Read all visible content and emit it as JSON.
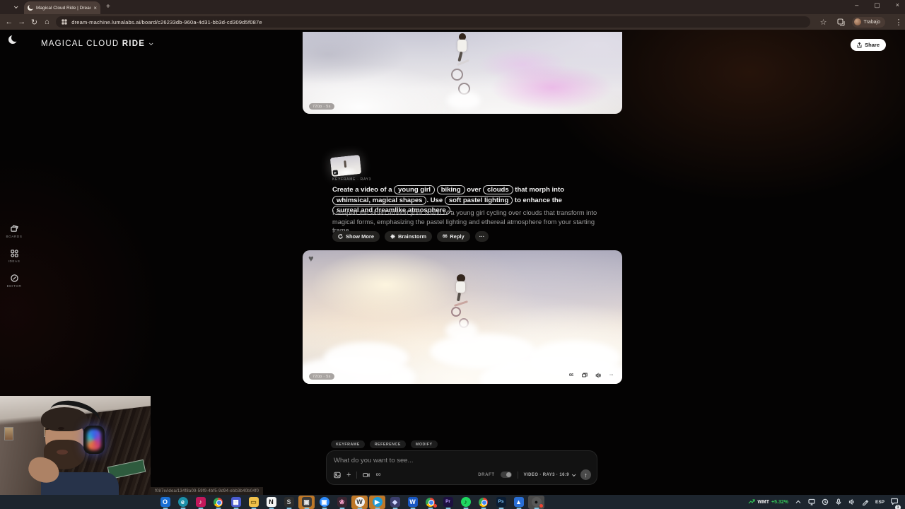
{
  "browser": {
    "tab_title": "Magical Cloud Ride | Dream M...",
    "tab_close": "×",
    "new_tab": "+",
    "window_controls": {
      "minimize": "–",
      "maximize": "▢",
      "close": "×"
    },
    "nav": {
      "back": "←",
      "forward": "→",
      "reload": "↻",
      "home": "⌂"
    },
    "url": "dream-machine.lumalabs.ai/board/c26233db-960a-4d31-bb3d-cd309d5f087e",
    "bookmark_star": "☆",
    "menu_kebab": "⋮",
    "profile_name": "Trabajo"
  },
  "header": {
    "title_regular": "MAGICAL CLOUD",
    "title_bold": "RIDE",
    "share_label": "Share"
  },
  "sidebar": {
    "items": [
      {
        "label": "BOARDS"
      },
      {
        "label": "IDEAS"
      },
      {
        "label": "EDITOR"
      }
    ]
  },
  "videos": {
    "badge_label": "720p · 5s",
    "heart": "♥"
  },
  "generation": {
    "keyframe_label": "KEYFRAME · RAY3",
    "prompt_segments": [
      {
        "type": "text",
        "text": "Create a video of a "
      },
      {
        "type": "pill",
        "text": "young girl"
      },
      {
        "type": "text",
        "text": " "
      },
      {
        "type": "pill",
        "text": "biking"
      },
      {
        "type": "text",
        "text": " over "
      },
      {
        "type": "pill",
        "text": "clouds"
      },
      {
        "type": "text",
        "text": " that morph into "
      },
      {
        "type": "pill",
        "text": "whimsical, magical shapes"
      },
      {
        "type": "text",
        "text": ". Use "
      },
      {
        "type": "pill",
        "text": "soft pastel lighting"
      },
      {
        "type": "text",
        "text": " to enhance the "
      },
      {
        "type": "pill",
        "text": "surreal and dreamlike atmosphere"
      },
      {
        "type": "text",
        "text": "."
      }
    ],
    "description": "I shaped the video around your vision of a young girl cycling over clouds that transform into magical forms, emphasizing the pastel lighting and ethereal atmosphere from your starting frame.",
    "actions": {
      "show_more": "Show More",
      "brainstorm": "Brainstorm",
      "reply": "Reply",
      "more": "···",
      "quote_glyph": "66"
    }
  },
  "video_actions": {
    "quote_glyph": "66",
    "more": "···"
  },
  "composer": {
    "tabs": [
      "KEYFRAME",
      "REFERENCE",
      "MODIFY"
    ],
    "placeholder": "What do you want to see...",
    "plus": "+",
    "loop": "∞",
    "draft_label": "DRAFT",
    "model_label": "VIDEO · RAY3 · 16:9",
    "send_arrow": "↑"
  },
  "statusbar": {
    "link_preview": "f087e/idea/134f8a09-59f9-4bf5-9d94-ebb3b40b04f0"
  },
  "taskbar": {
    "apps": [
      {
        "name": "outlook",
        "glyph": "O",
        "fg": "#ffffff",
        "bg": "#1a6fd4",
        "type": "sq",
        "run": true
      },
      {
        "name": "edge",
        "glyph": "e",
        "fg": "#ffffff",
        "bg": "#1b8fa8",
        "type": "round",
        "run": true
      },
      {
        "name": "music-app",
        "glyph": "♪",
        "fg": "#ffffff",
        "bg": "#c2185b",
        "type": "sq",
        "run": true
      },
      {
        "name": "chrome",
        "glyph": "",
        "fg": "",
        "bg": "",
        "type": "chrome",
        "run": true
      },
      {
        "name": "microsoft-store",
        "glyph": "▦",
        "fg": "#ffffff",
        "bg": "#4a5bd0",
        "type": "sq",
        "run": true
      },
      {
        "name": "file-explorer",
        "glyph": "▭",
        "fg": "#7a5c10",
        "bg": "#f2c14b",
        "type": "sq",
        "run": true
      },
      {
        "name": "notion",
        "glyph": "N",
        "fg": "#111111",
        "bg": "#f4f4f4",
        "type": "sq",
        "run": true
      },
      {
        "name": "sticky-app",
        "glyph": "S",
        "fg": "#cccccc",
        "bg": "#2d2d2d",
        "type": "sq",
        "run": true
      },
      {
        "name": "window-app",
        "glyph": "▣",
        "fg": "#e8e8e8",
        "bg": "#3a3a3a",
        "type": "sq",
        "run": true,
        "chip": "#bf7828"
      },
      {
        "name": "zoom",
        "glyph": "▣",
        "fg": "#ffffff",
        "bg": "#2d8cff",
        "type": "round",
        "run": true
      },
      {
        "name": "flower-app",
        "glyph": "❀",
        "fg": "#f2a0c8",
        "bg": "#3a2430",
        "type": "sq",
        "run": true
      },
      {
        "name": "w-app",
        "glyph": "W",
        "fg": "#333333",
        "bg": "#f0f0f0",
        "type": "round",
        "run": true,
        "chip": "#bf7828"
      },
      {
        "name": "play-app",
        "glyph": "▶",
        "fg": "#ffffff",
        "bg": "#1d9bd8",
        "type": "round",
        "run": true,
        "chip": "#bf7828"
      },
      {
        "name": "purple-app",
        "glyph": "◆",
        "fg": "#cfd8ff",
        "bg": "#3c3f6e",
        "type": "sq",
        "run": true
      },
      {
        "name": "word",
        "glyph": "W",
        "fg": "#ffffff",
        "bg": "#1857c3",
        "type": "sq",
        "run": true
      },
      {
        "name": "chrome-profile2",
        "glyph": "",
        "fg": "",
        "bg": "",
        "type": "chrome",
        "run": true,
        "dot": true
      },
      {
        "name": "premiere-pro",
        "glyph": "Pr",
        "fg": "#b79bff",
        "bg": "#1d1040",
        "type": "sq",
        "run": true
      },
      {
        "name": "spotify",
        "glyph": "♪",
        "fg": "#0d2b14",
        "bg": "#1ed760",
        "type": "round",
        "run": true
      },
      {
        "name": "chrome-profile3",
        "glyph": "",
        "fg": "",
        "bg": "",
        "type": "chrome",
        "run": true
      },
      {
        "name": "photoshop",
        "glyph": "Ps",
        "fg": "#7cc5ff",
        "bg": "#0b1d33",
        "type": "sq",
        "run": true
      },
      {
        "name": "photos-app",
        "glyph": "▲",
        "fg": "#ffffff",
        "bg": "#2a6fd6",
        "type": "sq",
        "run": true
      },
      {
        "name": "recorder-app",
        "glyph": "●",
        "fg": "#101010",
        "bg": "#585858",
        "type": "round",
        "run": true,
        "chip": "#4a4a4a",
        "dot": true
      }
    ],
    "tray": {
      "ticker": "WMT",
      "change": "+5.32%",
      "language": "ESP",
      "notification_count": "1"
    }
  }
}
